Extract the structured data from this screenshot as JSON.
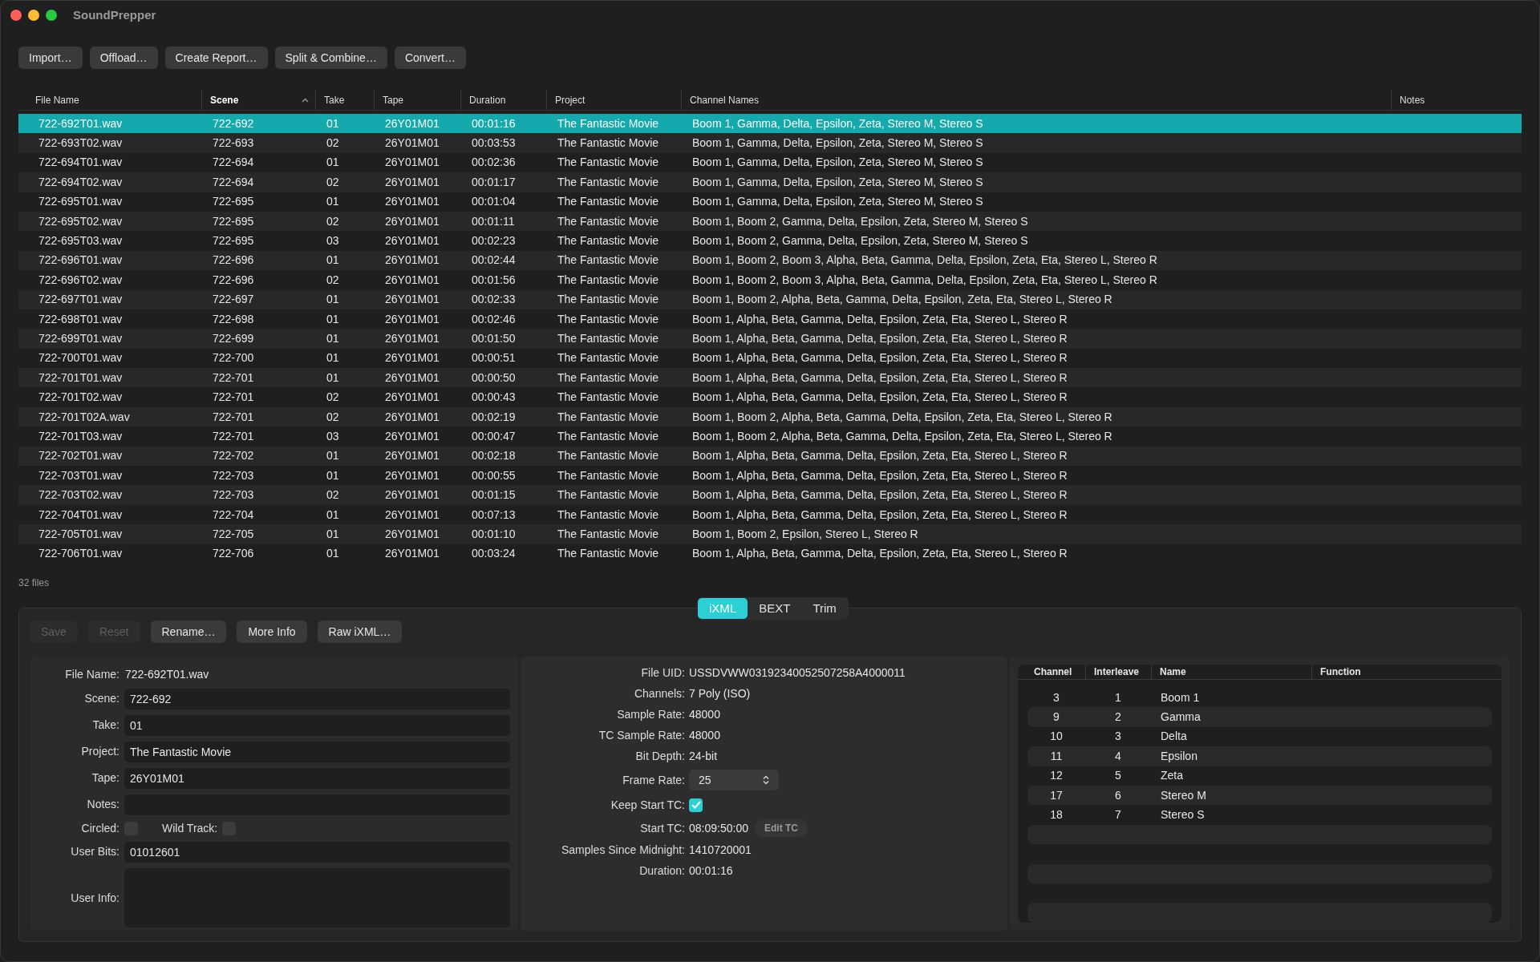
{
  "window": {
    "title": "SoundPrepper"
  },
  "toolbar": [
    "Import…",
    "Offload…",
    "Create Report…",
    "Split & Combine…",
    "Convert…"
  ],
  "file_table": {
    "columns": [
      {
        "label": "File Name",
        "sorted": false
      },
      {
        "label": "Scene",
        "sorted": true
      },
      {
        "label": "Take",
        "sorted": false
      },
      {
        "label": "Tape",
        "sorted": false
      },
      {
        "label": "Duration",
        "sorted": false
      },
      {
        "label": "Project",
        "sorted": false
      },
      {
        "label": "Channel Names",
        "sorted": false
      },
      {
        "label": "Notes",
        "sorted": false
      }
    ],
    "rows": [
      {
        "selected": true,
        "cells": [
          "722-692T01.wav",
          "722-692",
          "01",
          "26Y01M01",
          "00:01:16",
          "The Fantastic Movie",
          "Boom 1, Gamma, Delta, Epsilon, Zeta, Stereo M, Stereo S"
        ]
      },
      {
        "selected": false,
        "cells": [
          "722-693T02.wav",
          "722-693",
          "02",
          "26Y01M01",
          "00:03:53",
          "The Fantastic Movie",
          "Boom 1, Gamma, Delta, Epsilon, Zeta, Stereo M, Stereo S"
        ]
      },
      {
        "selected": false,
        "cells": [
          "722-694T01.wav",
          "722-694",
          "01",
          "26Y01M01",
          "00:02:36",
          "The Fantastic Movie",
          "Boom 1, Gamma, Delta, Epsilon, Zeta, Stereo M, Stereo S"
        ]
      },
      {
        "selected": false,
        "cells": [
          "722-694T02.wav",
          "722-694",
          "02",
          "26Y01M01",
          "00:01:17",
          "The Fantastic Movie",
          "Boom 1, Gamma, Delta, Epsilon, Zeta, Stereo M, Stereo S"
        ]
      },
      {
        "selected": false,
        "cells": [
          "722-695T01.wav",
          "722-695",
          "01",
          "26Y01M01",
          "00:01:04",
          "The Fantastic Movie",
          "Boom 1, Gamma, Delta, Epsilon, Zeta, Stereo M, Stereo S"
        ]
      },
      {
        "selected": false,
        "cells": [
          "722-695T02.wav",
          "722-695",
          "02",
          "26Y01M01",
          "00:01:11",
          "The Fantastic Movie",
          "Boom 1, Boom 2, Gamma, Delta, Epsilon, Zeta, Stereo M, Stereo S"
        ]
      },
      {
        "selected": false,
        "cells": [
          "722-695T03.wav",
          "722-695",
          "03",
          "26Y01M01",
          "00:02:23",
          "The Fantastic Movie",
          "Boom 1, Boom 2, Gamma, Delta, Epsilon, Zeta, Stereo M, Stereo S"
        ]
      },
      {
        "selected": false,
        "cells": [
          "722-696T01.wav",
          "722-696",
          "01",
          "26Y01M01",
          "00:02:44",
          "The Fantastic Movie",
          "Boom 1, Boom 2, Boom 3, Alpha, Beta, Gamma, Delta, Epsilon, Zeta, Eta, Stereo L, Stereo R"
        ]
      },
      {
        "selected": false,
        "cells": [
          "722-696T02.wav",
          "722-696",
          "02",
          "26Y01M01",
          "00:01:56",
          "The Fantastic Movie",
          "Boom 1, Boom 2, Boom 3, Alpha, Beta, Gamma, Delta, Epsilon, Zeta, Eta, Stereo L, Stereo R"
        ]
      },
      {
        "selected": false,
        "cells": [
          "722-697T01.wav",
          "722-697",
          "01",
          "26Y01M01",
          "00:02:33",
          "The Fantastic Movie",
          "Boom 1, Boom 2, Alpha, Beta, Gamma, Delta, Epsilon, Zeta, Eta, Stereo L, Stereo R"
        ]
      },
      {
        "selected": false,
        "cells": [
          "722-698T01.wav",
          "722-698",
          "01",
          "26Y01M01",
          "00:02:46",
          "The Fantastic Movie",
          "Boom 1, Alpha, Beta, Gamma, Delta, Epsilon, Zeta, Eta, Stereo L, Stereo R"
        ]
      },
      {
        "selected": false,
        "cells": [
          "722-699T01.wav",
          "722-699",
          "01",
          "26Y01M01",
          "00:01:50",
          "The Fantastic Movie",
          "Boom 1, Alpha, Beta, Gamma, Delta, Epsilon, Zeta, Eta, Stereo L, Stereo R"
        ]
      },
      {
        "selected": false,
        "cells": [
          "722-700T01.wav",
          "722-700",
          "01",
          "26Y01M01",
          "00:00:51",
          "The Fantastic Movie",
          "Boom 1, Alpha, Beta, Gamma, Delta, Epsilon, Zeta, Eta, Stereo L, Stereo R"
        ]
      },
      {
        "selected": false,
        "cells": [
          "722-701T01.wav",
          "722-701",
          "01",
          "26Y01M01",
          "00:00:50",
          "The Fantastic Movie",
          "Boom 1, Alpha, Beta, Gamma, Delta, Epsilon, Zeta, Eta, Stereo L, Stereo R"
        ]
      },
      {
        "selected": false,
        "cells": [
          "722-701T02.wav",
          "722-701",
          "02",
          "26Y01M01",
          "00:00:43",
          "The Fantastic Movie",
          "Boom 1, Alpha, Beta, Gamma, Delta, Epsilon, Zeta, Eta, Stereo L, Stereo R"
        ]
      },
      {
        "selected": false,
        "cells": [
          "722-701T02A.wav",
          "722-701",
          "02",
          "26Y01M01",
          "00:02:19",
          "The Fantastic Movie",
          "Boom 1, Boom 2, Alpha, Beta, Gamma, Delta, Epsilon, Zeta, Eta, Stereo L, Stereo R"
        ]
      },
      {
        "selected": false,
        "cells": [
          "722-701T03.wav",
          "722-701",
          "03",
          "26Y01M01",
          "00:00:47",
          "The Fantastic Movie",
          "Boom 1, Boom 2, Alpha, Beta, Gamma, Delta, Epsilon, Zeta, Eta, Stereo L, Stereo R"
        ]
      },
      {
        "selected": false,
        "cells": [
          "722-702T01.wav",
          "722-702",
          "01",
          "26Y01M01",
          "00:02:18",
          "The Fantastic Movie",
          "Boom 1, Alpha, Beta, Gamma, Delta, Epsilon, Zeta, Eta, Stereo L, Stereo R"
        ]
      },
      {
        "selected": false,
        "cells": [
          "722-703T01.wav",
          "722-703",
          "01",
          "26Y01M01",
          "00:00:55",
          "The Fantastic Movie",
          "Boom 1, Alpha, Beta, Gamma, Delta, Epsilon, Zeta, Eta, Stereo L, Stereo R"
        ]
      },
      {
        "selected": false,
        "cells": [
          "722-703T02.wav",
          "722-703",
          "02",
          "26Y01M01",
          "00:01:15",
          "The Fantastic Movie",
          "Boom 1, Alpha, Beta, Gamma, Delta, Epsilon, Zeta, Eta, Stereo L, Stereo R"
        ]
      },
      {
        "selected": false,
        "cells": [
          "722-704T01.wav",
          "722-704",
          "01",
          "26Y01M01",
          "00:07:13",
          "The Fantastic Movie",
          "Boom 1, Alpha, Beta, Gamma, Delta, Epsilon, Zeta, Eta, Stereo L, Stereo R"
        ]
      },
      {
        "selected": false,
        "cells": [
          "722-705T01.wav",
          "722-705",
          "01",
          "26Y01M01",
          "00:01:10",
          "The Fantastic Movie",
          "Boom 1, Boom 2, Epsilon, Stereo L, Stereo R"
        ]
      },
      {
        "selected": false,
        "cells": [
          "722-706T01.wav",
          "722-706",
          "01",
          "26Y01M01",
          "00:03:24",
          "The Fantastic Movie",
          "Boom 1, Alpha, Beta, Gamma, Delta, Epsilon, Zeta, Eta, Stereo L, Stereo R"
        ]
      }
    ]
  },
  "file_count": "32 files",
  "inspector": {
    "tabs": [
      {
        "label": "iXML",
        "selected": true
      },
      {
        "label": "BEXT",
        "selected": false
      },
      {
        "label": "Trim",
        "selected": false
      }
    ],
    "buttons": [
      {
        "label": "Save",
        "disabled": true
      },
      {
        "label": "Reset",
        "disabled": true
      },
      {
        "label": "Rename…",
        "disabled": false
      },
      {
        "label": "More Info",
        "disabled": false
      },
      {
        "label": "Raw iXML…",
        "disabled": false
      }
    ],
    "fields": [
      {
        "kind": "text",
        "label": "File Name:",
        "value": "722-692T01.wav"
      },
      {
        "kind": "input",
        "label": "Scene:",
        "value": "722-692"
      },
      {
        "kind": "input",
        "label": "Take:",
        "value": "01"
      },
      {
        "kind": "input",
        "label": "Project:",
        "value": "The Fantastic Movie"
      },
      {
        "kind": "input",
        "label": "Tape:",
        "value": "26Y01M01"
      },
      {
        "kind": "input",
        "label": "Notes:"
      },
      {
        "kind": "checkboxes",
        "items": [
          {
            "label": "Circled:",
            "checked": false
          },
          {
            "label": "Wild Track:",
            "checked": false
          }
        ]
      },
      {
        "kind": "input",
        "label": "User Bits:",
        "value": "01012601"
      },
      {
        "kind": "textarea",
        "label": "User Info:"
      }
    ],
    "info": [
      {
        "kind": "text",
        "label": "File UID:",
        "value": "USSDVWW03192340052507258A4000011"
      },
      {
        "kind": "text",
        "label": "Channels:",
        "value": "7 Poly (ISO)"
      },
      {
        "kind": "text",
        "label": "Sample Rate:",
        "value": "48000"
      },
      {
        "kind": "text",
        "label": "TC Sample Rate:",
        "value": "48000"
      },
      {
        "kind": "text",
        "label": "Bit Depth:",
        "value": "24-bit"
      },
      {
        "kind": "select",
        "label": "Frame Rate:",
        "value": "25"
      },
      {
        "kind": "checkbox",
        "label": "Keep Start TC:",
        "checked": true
      },
      {
        "kind": "text_button",
        "label": "Start TC:",
        "value": "08:09:50:00",
        "button": "Edit TC"
      },
      {
        "kind": "text",
        "label": "Samples Since Midnight:",
        "value": "1410720001"
      },
      {
        "kind": "text",
        "label": "Duration:",
        "value": "00:01:16"
      }
    ],
    "channels": {
      "columns": [
        "Channel",
        "Interleave",
        "Name",
        "Function"
      ],
      "rows": [
        {
          "cells": [
            "3",
            "1",
            "Boom 1"
          ]
        },
        {
          "cells": [
            "9",
            "2",
            "Gamma"
          ]
        },
        {
          "cells": [
            "10",
            "3",
            "Delta"
          ]
        },
        {
          "cells": [
            "11",
            "4",
            "Epsilon"
          ]
        },
        {
          "cells": [
            "12",
            "5",
            "Zeta"
          ]
        },
        {
          "cells": [
            "17",
            "6",
            "Stereo M"
          ]
        },
        {
          "cells": [
            "18",
            "7",
            "Stereo S"
          ]
        }
      ]
    }
  }
}
